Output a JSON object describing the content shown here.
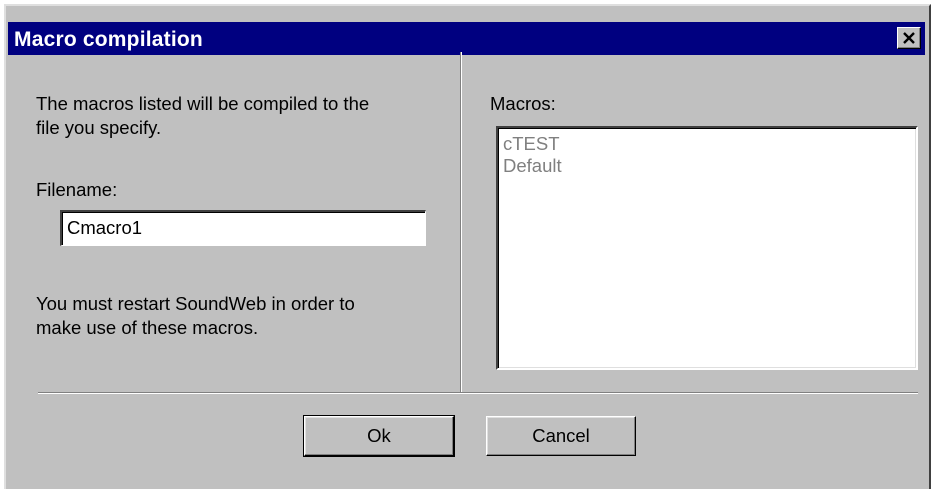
{
  "window": {
    "title": "Macro compilation",
    "title_bar_color": "#000080",
    "face_color": "#c0c0c0"
  },
  "left_panel": {
    "description_line1": "The macros listed will be compiled to the",
    "description_line2": "file you specify.",
    "filename_label": "Filename:",
    "filename_value": "Cmacro1",
    "restart_line1": "You must restart SoundWeb in order to",
    "restart_line2": "make use of these macros."
  },
  "right_panel": {
    "macros_label": "Macros:",
    "macros": [
      {
        "label": "cTEST"
      },
      {
        "label": "Default"
      }
    ]
  },
  "buttons": {
    "ok_label": "Ok",
    "cancel_label": "Cancel"
  },
  "icons": {
    "close": "close-icon"
  }
}
